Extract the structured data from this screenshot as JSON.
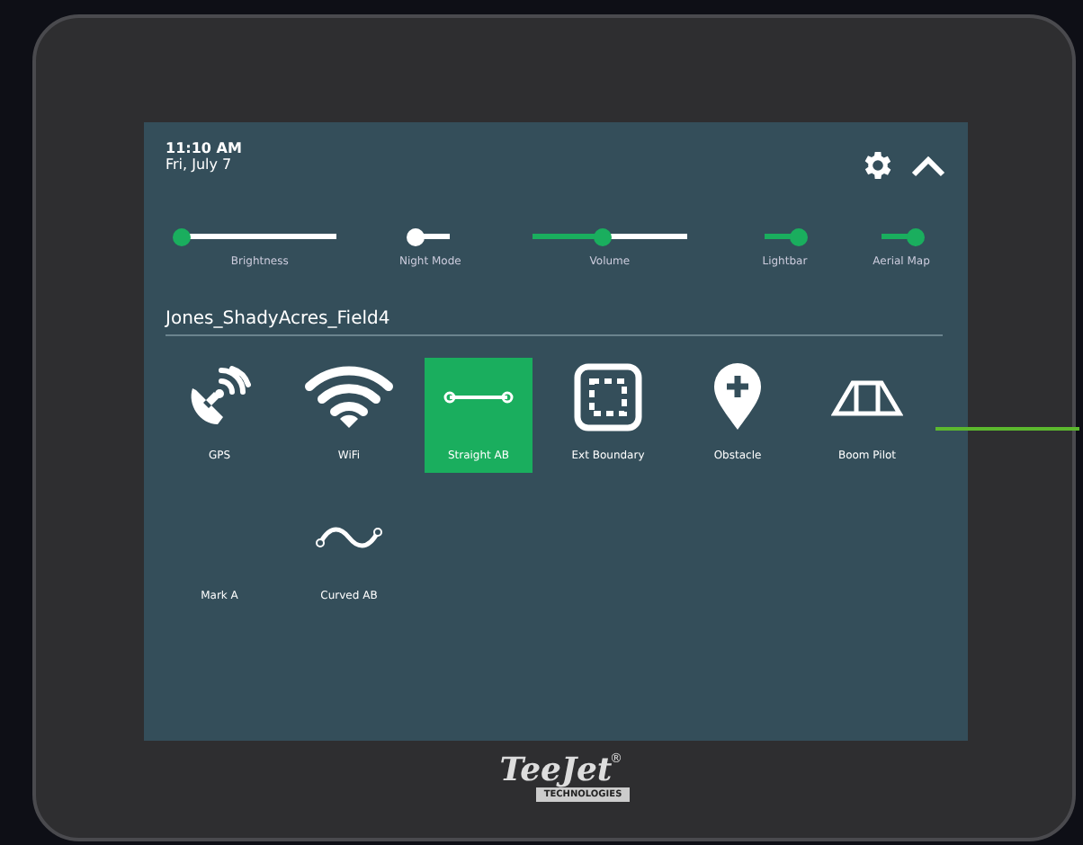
{
  "status": {
    "time": "11:10 AM",
    "date": "Fri, July 7"
  },
  "controls": [
    {
      "kind": "slider",
      "label": "Brightness",
      "level": 0
    },
    {
      "kind": "toggle",
      "label": "Night Mode",
      "on": false
    },
    {
      "kind": "slider",
      "label": "Volume",
      "level": 0.45
    },
    {
      "kind": "toggle",
      "label": "Lightbar",
      "on": true
    },
    {
      "kind": "toggle",
      "label": "Aerial Map",
      "on": true
    }
  ],
  "job_name": "Jones_ShadyAcres_Field4",
  "tiles": [
    {
      "kind": "gps",
      "label": "GPS",
      "selected": false
    },
    {
      "kind": "wifi",
      "label": "WiFi",
      "selected": false
    },
    {
      "kind": "straight",
      "label": "Straight AB",
      "selected": true
    },
    {
      "kind": "boundary",
      "label": "Ext Boundary",
      "selected": false
    },
    {
      "kind": "obstacle",
      "label": "Obstacle",
      "selected": false
    },
    {
      "kind": "boom",
      "label": "Boom Pilot",
      "selected": false
    },
    {
      "kind": "mark",
      "label": "Mark A",
      "selected": false
    },
    {
      "kind": "curved",
      "label": "Curved AB",
      "selected": false
    }
  ],
  "brand": {
    "name": "TeeJet",
    "mark": "®",
    "tagline": "TECHNOLOGIES"
  }
}
